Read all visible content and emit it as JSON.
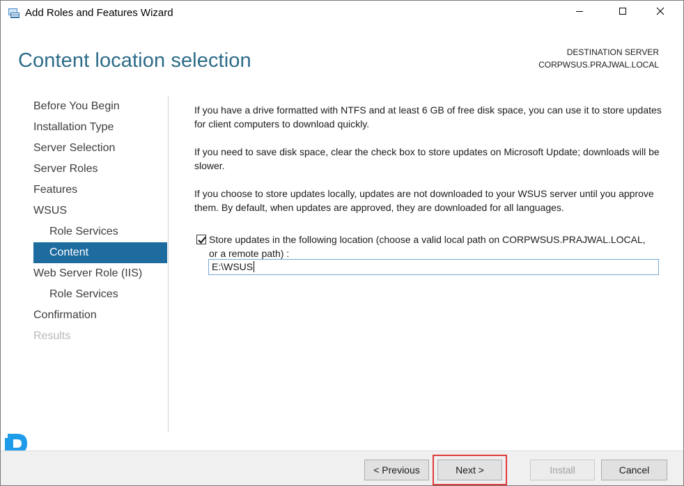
{
  "window": {
    "title": "Add Roles and Features Wizard",
    "controls": {
      "minimize": "minimize-icon",
      "maximize": "maximize-icon",
      "close": "close-icon"
    }
  },
  "header": {
    "page_title": "Content location selection",
    "destination_label": "DESTINATION SERVER",
    "destination_server": "CORPWSUS.PRAJWAL.LOCAL"
  },
  "nav": {
    "items": [
      {
        "label": "Before You Begin",
        "state": "normal",
        "level": 0
      },
      {
        "label": "Installation Type",
        "state": "normal",
        "level": 0
      },
      {
        "label": "Server Selection",
        "state": "normal",
        "level": 0
      },
      {
        "label": "Server Roles",
        "state": "normal",
        "level": 0
      },
      {
        "label": "Features",
        "state": "normal",
        "level": 0
      },
      {
        "label": "WSUS",
        "state": "normal",
        "level": 0
      },
      {
        "label": "Role Services",
        "state": "normal",
        "level": 1
      },
      {
        "label": "Content",
        "state": "active",
        "level": 1
      },
      {
        "label": "Web Server Role (IIS)",
        "state": "normal",
        "level": 0
      },
      {
        "label": "Role Services",
        "state": "normal",
        "level": 1
      },
      {
        "label": "Confirmation",
        "state": "normal",
        "level": 0
      },
      {
        "label": "Results",
        "state": "disabled",
        "level": 0
      }
    ]
  },
  "content": {
    "para1": "If you have a drive formatted with NTFS and at least 6 GB of free disk space, you can use it to store updates for client computers to download quickly.",
    "para2": "If you need to save disk space, clear the check box to store updates on Microsoft Update; downloads will be slower.",
    "para3": "If you choose to store updates locally, updates are not downloaded to your WSUS server until you approve them. By default, when updates are approved, they are downloaded for all languages.",
    "store_checkbox": {
      "checked": true,
      "label": "Store updates in the following location (choose a valid local path on CORPWSUS.PRAJWAL.LOCAL, or a remote path) :"
    },
    "path_value": "E:\\WSUS"
  },
  "footer": {
    "previous_label": "< Previous",
    "next_label": "Next >",
    "install_label": "Install",
    "cancel_label": "Cancel"
  },
  "colors": {
    "title_accent": "#2c6b88",
    "nav_active_bg": "#1e6ba0",
    "highlight_border": "#e03a3a",
    "logo_blue": "#1e9be9"
  }
}
